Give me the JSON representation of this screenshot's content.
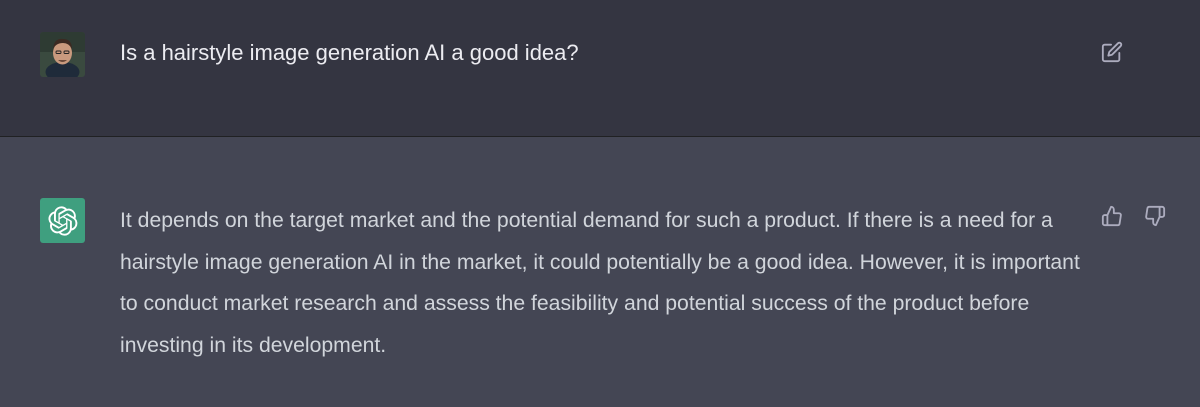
{
  "conversation": {
    "user_message": {
      "avatar": "user-profile-photo",
      "text": "Is a hairstyle image generation AI a good idea?",
      "edit_icon": "edit-icon"
    },
    "assistant_message": {
      "avatar": "openai-logo-icon",
      "text": "It depends on the target market and the potential demand for such a product. If there is a need for a hairstyle image generation AI in the market, it could potentially be a good idea. However, it is important to conduct market research and assess the feasibility and potential success of the product before investing in its development.",
      "feedback_icons": [
        "thumbs-up-icon",
        "thumbs-down-icon"
      ]
    }
  },
  "colors": {
    "user_bg": "#343541",
    "assistant_bg": "#444654",
    "assistant_avatar_bg": "#3f9f7f",
    "user_text": "#ececf1",
    "assistant_text": "#d1d5db",
    "icon_color": "#acacbe"
  }
}
